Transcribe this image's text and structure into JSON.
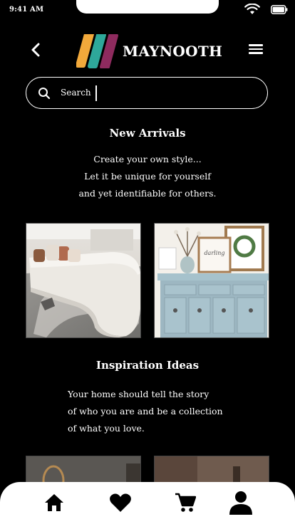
{
  "status_bar": {
    "time": "9:41 AM",
    "wifi_icon": "wifi-icon",
    "battery_icon": "battery-icon"
  },
  "header": {
    "back_icon": "chevron-left-icon",
    "logo_icon": "maynooth-logo-mark",
    "brand_name": "MAYNOOTH",
    "menu_icon": "hamburger-menu-icon",
    "logo_colors": [
      "#F2A93B",
      "#2EA89A",
      "#8E2B5E"
    ]
  },
  "search": {
    "icon": "search-icon",
    "placeholder": "Search",
    "value": ""
  },
  "new_arrivals": {
    "title": "New Arrivals",
    "lines": [
      "Create your own style...",
      "Let it be unique for yourself",
      "and yet identifiable for others."
    ],
    "photos": [
      {
        "name": "curved-white-sofa-photo"
      },
      {
        "name": "blue-sideboard-photo"
      }
    ]
  },
  "inspiration": {
    "title": "Inspiration Ideas",
    "lines": [
      "Your home should tell the story",
      "of who you are and be a collection",
      "of what you love."
    ],
    "photos": [
      {
        "name": "mirror-room-photo"
      },
      {
        "name": "wooden-interior-photo"
      }
    ]
  },
  "tab_bar": {
    "tabs": [
      {
        "icon": "home-icon"
      },
      {
        "icon": "heart-icon"
      },
      {
        "icon": "cart-icon"
      },
      {
        "icon": "user-icon"
      }
    ]
  }
}
